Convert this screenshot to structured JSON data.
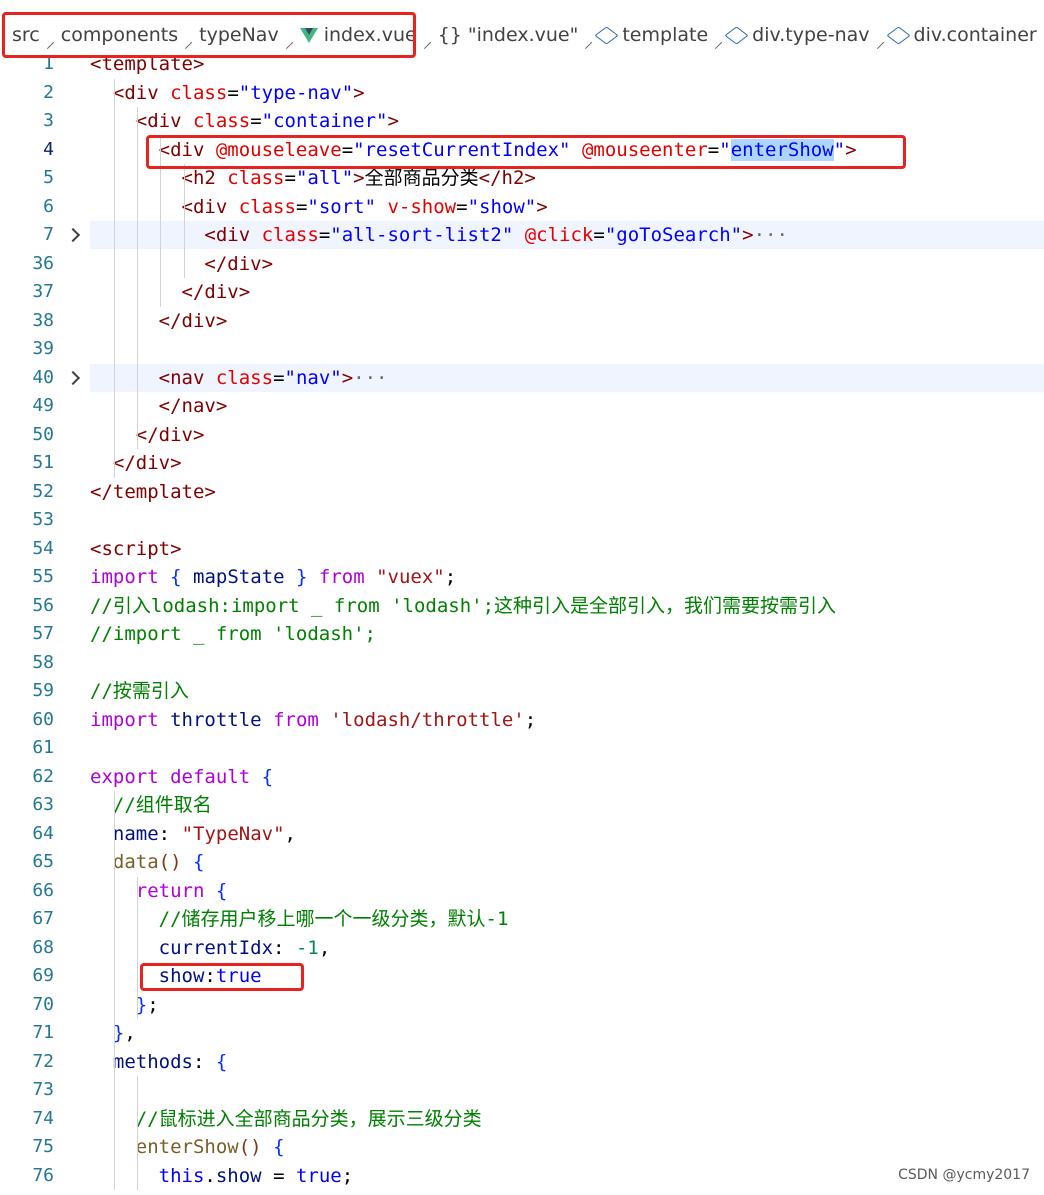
{
  "breadcrumb": {
    "items": [
      "src",
      "components",
      "typeNav",
      "index.vue",
      "\"index.vue\"",
      "template",
      "div.type-nav",
      "div.container"
    ]
  },
  "code_lines": [
    {
      "n": "1",
      "text": "<template>"
    },
    {
      "n": "2",
      "text": "  <div class=\"type-nav\">"
    },
    {
      "n": "3",
      "text": "    <div class=\"container\">"
    },
    {
      "n": "4",
      "text": "      <div @mouseleave=\"resetCurrentIndex\" @mouseenter=\"enterShow\">"
    },
    {
      "n": "5",
      "text": "        <h2 class=\"all\">全部商品分类</h2>"
    },
    {
      "n": "6",
      "text": "        <div class=\"sort\" v-show=\"show\">"
    },
    {
      "n": "7",
      "text": "          <div class=\"all-sort-list2\" @click=\"goToSearch\">···"
    },
    {
      "n": "36",
      "text": "          </div>"
    },
    {
      "n": "37",
      "text": "        </div>"
    },
    {
      "n": "38",
      "text": "      </div>"
    },
    {
      "n": "39",
      "text": ""
    },
    {
      "n": "40",
      "text": "      <nav class=\"nav\">···"
    },
    {
      "n": "49",
      "text": "      </nav>"
    },
    {
      "n": "50",
      "text": "    </div>"
    },
    {
      "n": "51",
      "text": "  </div>"
    },
    {
      "n": "52",
      "text": "</template>"
    },
    {
      "n": "53",
      "text": ""
    },
    {
      "n": "54",
      "text": "<script>"
    },
    {
      "n": "55",
      "text": "import { mapState } from \"vuex\";"
    },
    {
      "n": "56",
      "text": "//引入lodash:import _ from 'lodash';这种引入是全部引入，我们需要按需引入"
    },
    {
      "n": "57",
      "text": "//import _ from 'lodash';"
    },
    {
      "n": "58",
      "text": ""
    },
    {
      "n": "59",
      "text": "//按需引入"
    },
    {
      "n": "60",
      "text": "import throttle from 'lodash/throttle';"
    },
    {
      "n": "61",
      "text": ""
    },
    {
      "n": "62",
      "text": "export default {"
    },
    {
      "n": "63",
      "text": "  //组件取名"
    },
    {
      "n": "64",
      "text": "  name: \"TypeNav\","
    },
    {
      "n": "65",
      "text": "  data() {"
    },
    {
      "n": "66",
      "text": "    return {"
    },
    {
      "n": "67",
      "text": "      //储存用户移上哪一个一级分类，默认-1"
    },
    {
      "n": "68",
      "text": "      currentIdx: -1,"
    },
    {
      "n": "69",
      "text": "      show:true"
    },
    {
      "n": "70",
      "text": "    };"
    },
    {
      "n": "71",
      "text": "  },"
    },
    {
      "n": "72",
      "text": "  methods: {"
    },
    {
      "n": "73",
      "text": ""
    },
    {
      "n": "74",
      "text": "    //鼠标进入全部商品分类，展示三级分类"
    },
    {
      "n": "75",
      "text": "    enterShow() {"
    },
    {
      "n": "76",
      "text": "      this.show = true;"
    }
  ],
  "watermark": "CSDN @ycmy2017",
  "colors": {
    "highlight_box": "#e8231f",
    "selection": "#add6ff",
    "line_number": "#237893"
  }
}
